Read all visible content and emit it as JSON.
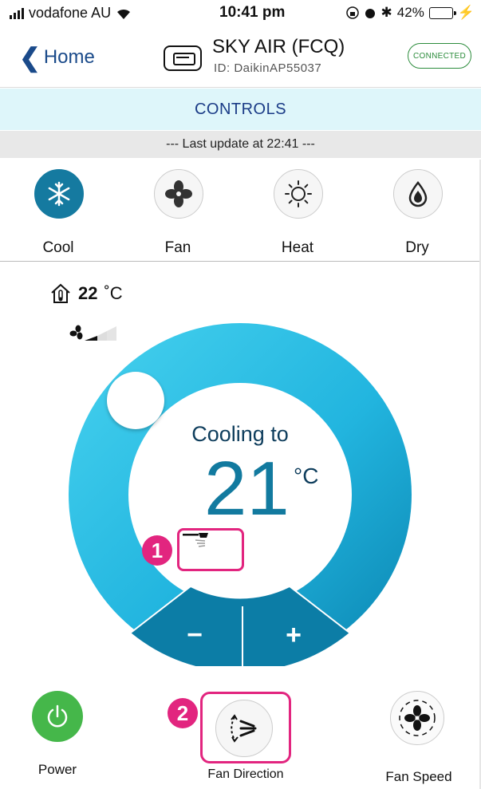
{
  "status_bar": {
    "carrier": "vodafone AU",
    "time": "10:41 pm",
    "battery": "42%",
    "battery_level": 0.42
  },
  "header": {
    "back_label": "Home",
    "device_name": "SKY AIR (FCQ)",
    "device_id": "ID: DaikinAP55037",
    "status_pill": "CONNECTED"
  },
  "section_title": "CONTROLS",
  "last_update": "--- Last update at 22:41 ---",
  "modes": [
    {
      "label": "Cool",
      "icon": "snowflake-icon",
      "active": true
    },
    {
      "label": "Fan",
      "icon": "fan-icon",
      "active": false
    },
    {
      "label": "Heat",
      "icon": "sun-icon",
      "active": false
    },
    {
      "label": "Dry",
      "icon": "droplet-icon",
      "active": false
    }
  ],
  "indoor": {
    "value": "22",
    "unit": "˚C"
  },
  "dial": {
    "mode_text": "Cooling to",
    "setpoint": "21",
    "unit": "°C",
    "minus_label": "−",
    "plus_label": "+",
    "fan_speed_level": 1,
    "fan_speed_max": 3
  },
  "badges": {
    "one": "1",
    "two": "2"
  },
  "bottom": {
    "power_label": "Power",
    "fan_direction_label": "Fan Direction",
    "fan_speed_label": "Fan Speed"
  },
  "colors": {
    "accent": "#157aa0",
    "ring_light": "#33c6e8",
    "ring_dark": "#0a84b0",
    "highlight": "#e2257f",
    "power": "#45b74a",
    "nav": "#1a4a8a"
  }
}
